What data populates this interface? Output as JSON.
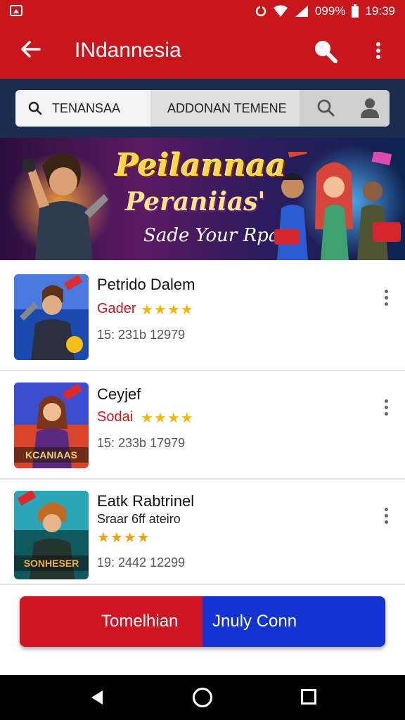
{
  "statusbar": {
    "battery_percent": "099%",
    "time": "19:39"
  },
  "appbar": {
    "title": "INdannesia"
  },
  "tabs": [
    {
      "label": "TENANSAA"
    },
    {
      "label": "ADDONAN TEMENE"
    }
  ],
  "banner": {
    "title_line1": "Peilannaa",
    "title_line2": "Peraniias'",
    "subtitle": "Sade Your Rpam"
  },
  "apps": [
    {
      "name": "Petrido Dalem",
      "category": "Gader",
      "rating": 4,
      "meta": "15: 231b 12979"
    },
    {
      "name": "Ceyjef",
      "category": "Sodai",
      "rating": 4,
      "meta": "15: 233b 17979"
    },
    {
      "name": "Eatk Rabtrinel",
      "category": "Sraar 6ff ateiro",
      "rating": 4,
      "meta": "19: 2442 12299"
    }
  ],
  "thumb_labels": [
    "KCANIAAS",
    "SONHESER"
  ],
  "cta": {
    "left_label": "Tomelhian",
    "right_label": "Jnuly Conn"
  },
  "colors": {
    "primary_red": "#c8161c",
    "navy": "#1a2d4e",
    "star": "#f2b705",
    "cta_blue": "#1334d0"
  },
  "icons": {
    "back": "arrow-left",
    "search": "magnifier",
    "more": "three-dots-vertical",
    "user": "person"
  }
}
